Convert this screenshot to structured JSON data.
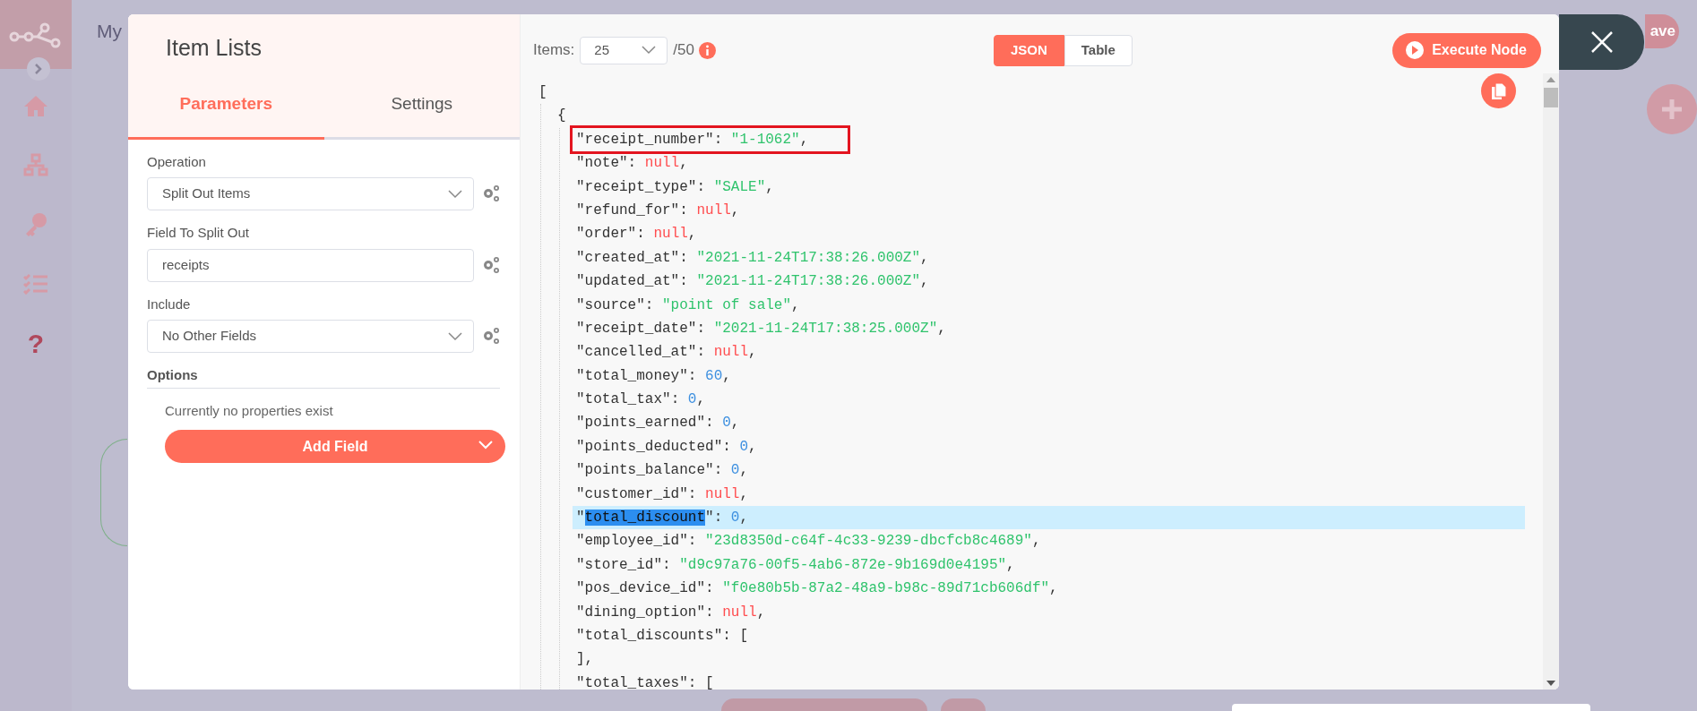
{
  "background": {
    "workflow_name": "My",
    "save_button": "ave",
    "help_glyph": "?"
  },
  "node_panel": {
    "title": "Item Lists",
    "tabs": [
      {
        "label": "Parameters",
        "selected": true
      },
      {
        "label": "Settings",
        "selected": false
      }
    ],
    "parameters": [
      {
        "label": "Operation",
        "kind": "select",
        "value": "Split Out Items"
      },
      {
        "label": "Field To Split Out",
        "kind": "input",
        "value": "receipts"
      },
      {
        "label": "Include",
        "kind": "select",
        "value": "No Other Fields"
      }
    ],
    "options": {
      "heading": "Options",
      "empty_text": "Currently no properties exist",
      "add_button": "Add Field"
    }
  },
  "output_panel": {
    "items_label": "Items:",
    "items_value": "25",
    "items_total": "/50",
    "views": [
      {
        "label": "JSON",
        "selected": true
      },
      {
        "label": "Table",
        "selected": false
      }
    ],
    "execute_button": "Execute Node",
    "json_tree": [
      {
        "segments": [
          {
            "text": "[",
            "kind": "punct"
          }
        ],
        "children": [
          {
            "segments": [
              {
                "text": "{",
                "kind": "punct"
              }
            ],
            "children": [
              {
                "boxed": true,
                "segments": [
                  {
                    "text": "\"receipt_number\"",
                    "kind": "key"
                  },
                  {
                    "text": ": ",
                    "kind": "punct"
                  },
                  {
                    "text": "\"1-1062\"",
                    "kind": "string"
                  },
                  {
                    "text": ",",
                    "kind": "punct"
                  }
                ]
              },
              {
                "segments": [
                  {
                    "text": "\"note\"",
                    "kind": "key"
                  },
                  {
                    "text": ": ",
                    "kind": "punct"
                  },
                  {
                    "text": "null",
                    "kind": "null"
                  },
                  {
                    "text": ",",
                    "kind": "punct"
                  }
                ]
              },
              {
                "segments": [
                  {
                    "text": "\"receipt_type\"",
                    "kind": "key"
                  },
                  {
                    "text": ": ",
                    "kind": "punct"
                  },
                  {
                    "text": "\"SALE\"",
                    "kind": "string"
                  },
                  {
                    "text": ",",
                    "kind": "punct"
                  }
                ]
              },
              {
                "segments": [
                  {
                    "text": "\"refund_for\"",
                    "kind": "key"
                  },
                  {
                    "text": ": ",
                    "kind": "punct"
                  },
                  {
                    "text": "null",
                    "kind": "null"
                  },
                  {
                    "text": ",",
                    "kind": "punct"
                  }
                ]
              },
              {
                "segments": [
                  {
                    "text": "\"order\"",
                    "kind": "key"
                  },
                  {
                    "text": ": ",
                    "kind": "punct"
                  },
                  {
                    "text": "null",
                    "kind": "null"
                  },
                  {
                    "text": ",",
                    "kind": "punct"
                  }
                ]
              },
              {
                "segments": [
                  {
                    "text": "\"created_at\"",
                    "kind": "key"
                  },
                  {
                    "text": ": ",
                    "kind": "punct"
                  },
                  {
                    "text": "\"2021-11-24T17:38:26.000Z\"",
                    "kind": "string"
                  },
                  {
                    "text": ",",
                    "kind": "punct"
                  }
                ]
              },
              {
                "segments": [
                  {
                    "text": "\"updated_at\"",
                    "kind": "key"
                  },
                  {
                    "text": ": ",
                    "kind": "punct"
                  },
                  {
                    "text": "\"2021-11-24T17:38:26.000Z\"",
                    "kind": "string"
                  },
                  {
                    "text": ",",
                    "kind": "punct"
                  }
                ]
              },
              {
                "segments": [
                  {
                    "text": "\"source\"",
                    "kind": "key"
                  },
                  {
                    "text": ": ",
                    "kind": "punct"
                  },
                  {
                    "text": "\"point of sale\"",
                    "kind": "string"
                  },
                  {
                    "text": ",",
                    "kind": "punct"
                  }
                ]
              },
              {
                "segments": [
                  {
                    "text": "\"receipt_date\"",
                    "kind": "key"
                  },
                  {
                    "text": ": ",
                    "kind": "punct"
                  },
                  {
                    "text": "\"2021-11-24T17:38:25.000Z\"",
                    "kind": "string"
                  },
                  {
                    "text": ",",
                    "kind": "punct"
                  }
                ]
              },
              {
                "segments": [
                  {
                    "text": "\"cancelled_at\"",
                    "kind": "key"
                  },
                  {
                    "text": ": ",
                    "kind": "punct"
                  },
                  {
                    "text": "null",
                    "kind": "null"
                  },
                  {
                    "text": ",",
                    "kind": "punct"
                  }
                ]
              },
              {
                "segments": [
                  {
                    "text": "\"total_money\"",
                    "kind": "key"
                  },
                  {
                    "text": ": ",
                    "kind": "punct"
                  },
                  {
                    "text": "60",
                    "kind": "number"
                  },
                  {
                    "text": ",",
                    "kind": "punct"
                  }
                ]
              },
              {
                "segments": [
                  {
                    "text": "\"total_tax\"",
                    "kind": "key"
                  },
                  {
                    "text": ": ",
                    "kind": "punct"
                  },
                  {
                    "text": "0",
                    "kind": "number"
                  },
                  {
                    "text": ",",
                    "kind": "punct"
                  }
                ]
              },
              {
                "segments": [
                  {
                    "text": "\"points_earned\"",
                    "kind": "key"
                  },
                  {
                    "text": ": ",
                    "kind": "punct"
                  },
                  {
                    "text": "0",
                    "kind": "number"
                  },
                  {
                    "text": ",",
                    "kind": "punct"
                  }
                ]
              },
              {
                "segments": [
                  {
                    "text": "\"points_deducted\"",
                    "kind": "key"
                  },
                  {
                    "text": ": ",
                    "kind": "punct"
                  },
                  {
                    "text": "0",
                    "kind": "number"
                  },
                  {
                    "text": ",",
                    "kind": "punct"
                  }
                ]
              },
              {
                "segments": [
                  {
                    "text": "\"points_balance\"",
                    "kind": "key"
                  },
                  {
                    "text": ": ",
                    "kind": "punct"
                  },
                  {
                    "text": "0",
                    "kind": "number"
                  },
                  {
                    "text": ",",
                    "kind": "punct"
                  }
                ]
              },
              {
                "segments": [
                  {
                    "text": "\"customer_id\"",
                    "kind": "key"
                  },
                  {
                    "text": ": ",
                    "kind": "punct"
                  },
                  {
                    "text": "null",
                    "kind": "null"
                  },
                  {
                    "text": ",",
                    "kind": "punct"
                  }
                ]
              },
              {
                "highlighted": true,
                "segments": [
                  {
                    "text": "\"",
                    "kind": "key"
                  },
                  {
                    "text": "total_discount",
                    "kind": "selection"
                  },
                  {
                    "text": "\"",
                    "kind": "key"
                  },
                  {
                    "text": ": ",
                    "kind": "punct"
                  },
                  {
                    "text": "0",
                    "kind": "number"
                  },
                  {
                    "text": ",",
                    "kind": "punct"
                  }
                ]
              },
              {
                "segments": [
                  {
                    "text": "\"employee_id\"",
                    "kind": "key"
                  },
                  {
                    "text": ": ",
                    "kind": "punct"
                  },
                  {
                    "text": "\"23d8350d-c64f-4c33-9239-dbcfcb8c4689\"",
                    "kind": "string"
                  },
                  {
                    "text": ",",
                    "kind": "punct"
                  }
                ]
              },
              {
                "segments": [
                  {
                    "text": "\"store_id\"",
                    "kind": "key"
                  },
                  {
                    "text": ": ",
                    "kind": "punct"
                  },
                  {
                    "text": "\"d9c97a76-00f5-4ab6-872e-9b169d0e4195\"",
                    "kind": "string"
                  },
                  {
                    "text": ",",
                    "kind": "punct"
                  }
                ]
              },
              {
                "segments": [
                  {
                    "text": "\"pos_device_id\"",
                    "kind": "key"
                  },
                  {
                    "text": ": ",
                    "kind": "punct"
                  },
                  {
                    "text": "\"f0e80b5b-87a2-48a9-b98c-89d71cb606df\"",
                    "kind": "string"
                  },
                  {
                    "text": ",",
                    "kind": "punct"
                  }
                ]
              },
              {
                "segments": [
                  {
                    "text": "\"dining_option\"",
                    "kind": "key"
                  },
                  {
                    "text": ": ",
                    "kind": "punct"
                  },
                  {
                    "text": "null",
                    "kind": "null"
                  },
                  {
                    "text": ",",
                    "kind": "punct"
                  }
                ]
              },
              {
                "segments": [
                  {
                    "text": "\"total_discounts\"",
                    "kind": "key"
                  },
                  {
                    "text": ": [",
                    "kind": "punct"
                  }
                ],
                "close": [
                  {
                    "text": "],",
                    "kind": "punct"
                  }
                ]
              },
              {
                "segments": [
                  {
                    "text": "\"total_taxes\"",
                    "kind": "key"
                  },
                  {
                    "text": ": [",
                    "kind": "punct"
                  }
                ]
              }
            ]
          }
        ]
      }
    ]
  }
}
